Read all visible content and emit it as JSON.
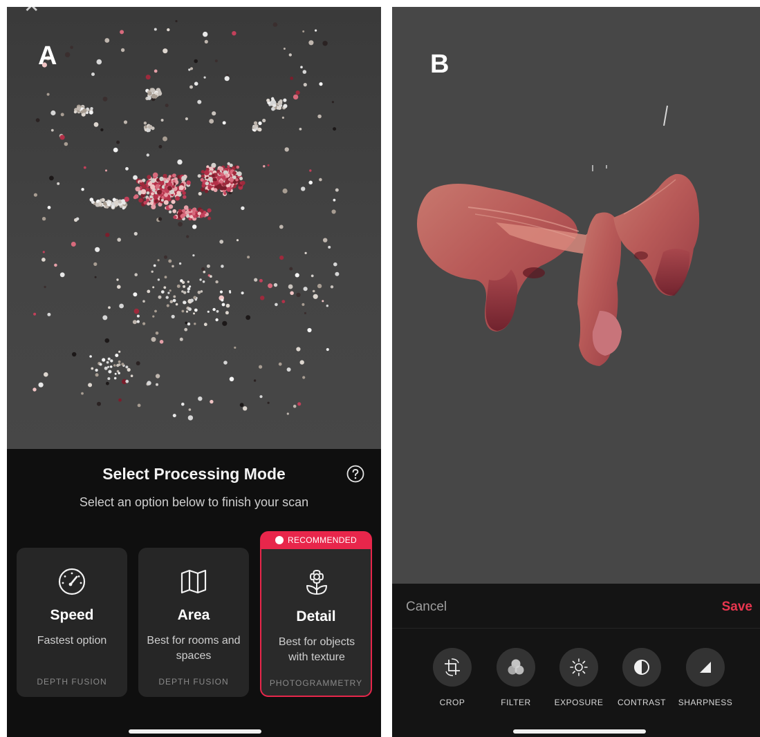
{
  "panel_a": {
    "letter": "A",
    "title": "Select Processing Mode",
    "subtitle": "Select an option below to finish your scan",
    "recommended_label": "RECOMMENDED",
    "modes": [
      {
        "name": "Speed",
        "desc": "Fastest option",
        "tech": "DEPTH FUSION",
        "icon": "speedometer-icon"
      },
      {
        "name": "Area",
        "desc": "Best for rooms and spaces",
        "tech": "DEPTH FUSION",
        "icon": "map-icon"
      },
      {
        "name": "Detail",
        "desc": "Best for objects with texture",
        "tech": "PHOTOGRAMMETRY",
        "icon": "flower-icon"
      }
    ]
  },
  "panel_b": {
    "letter": "B",
    "cancel_label": "Cancel",
    "save_label": "Save",
    "tools": [
      {
        "label": "CROP",
        "icon": "crop-rotate-icon"
      },
      {
        "label": "FILTER",
        "icon": "filter-icon"
      },
      {
        "label": "EXPOSURE",
        "icon": "sun-icon"
      },
      {
        "label": "CONTRAST",
        "icon": "contrast-icon"
      },
      {
        "label": "SHARPNESS",
        "icon": "sharpness-icon"
      }
    ]
  },
  "colors": {
    "accent": "#e8264b",
    "save": "#e8364f",
    "sheet_bg": "#0f0f0f",
    "card_bg": "#262626",
    "viewport_bg": "#474747"
  }
}
